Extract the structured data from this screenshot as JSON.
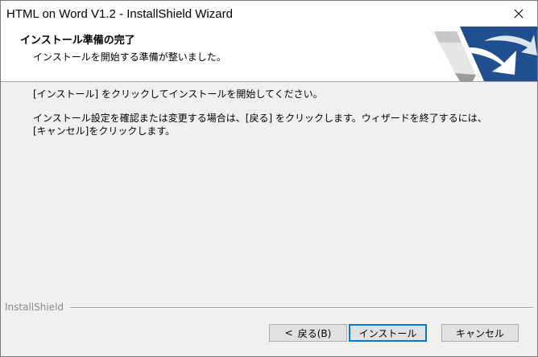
{
  "window": {
    "title": "HTML on Word V1.2 - InstallShield Wizard",
    "close_icon": "close-icon"
  },
  "banner": {
    "heading": "インストール準備の完了",
    "subheading": "インストールを開始する準備が整いました。",
    "logo_icon": "installshield-logo-icon",
    "colors": {
      "logo_blue": "#1f4f8e"
    }
  },
  "content": {
    "line1": "[インストール] をクリックしてインストールを開始してください。",
    "line2": "インストール設定を確認または変更する場合は、[戻る] をクリックします。ウィザードを終了するには、",
    "line3": "[キャンセル]をクリックします。"
  },
  "footer": {
    "brand": "InstallShield"
  },
  "buttons": {
    "back_chevron": "<",
    "back_label": "戻る(B)",
    "install_label": "インストール",
    "cancel_label": "キャンセル"
  },
  "colors": {
    "focus_border": "#0078d7",
    "button_face": "#e1e1e1",
    "dialog_bg": "#f0f0f0"
  }
}
